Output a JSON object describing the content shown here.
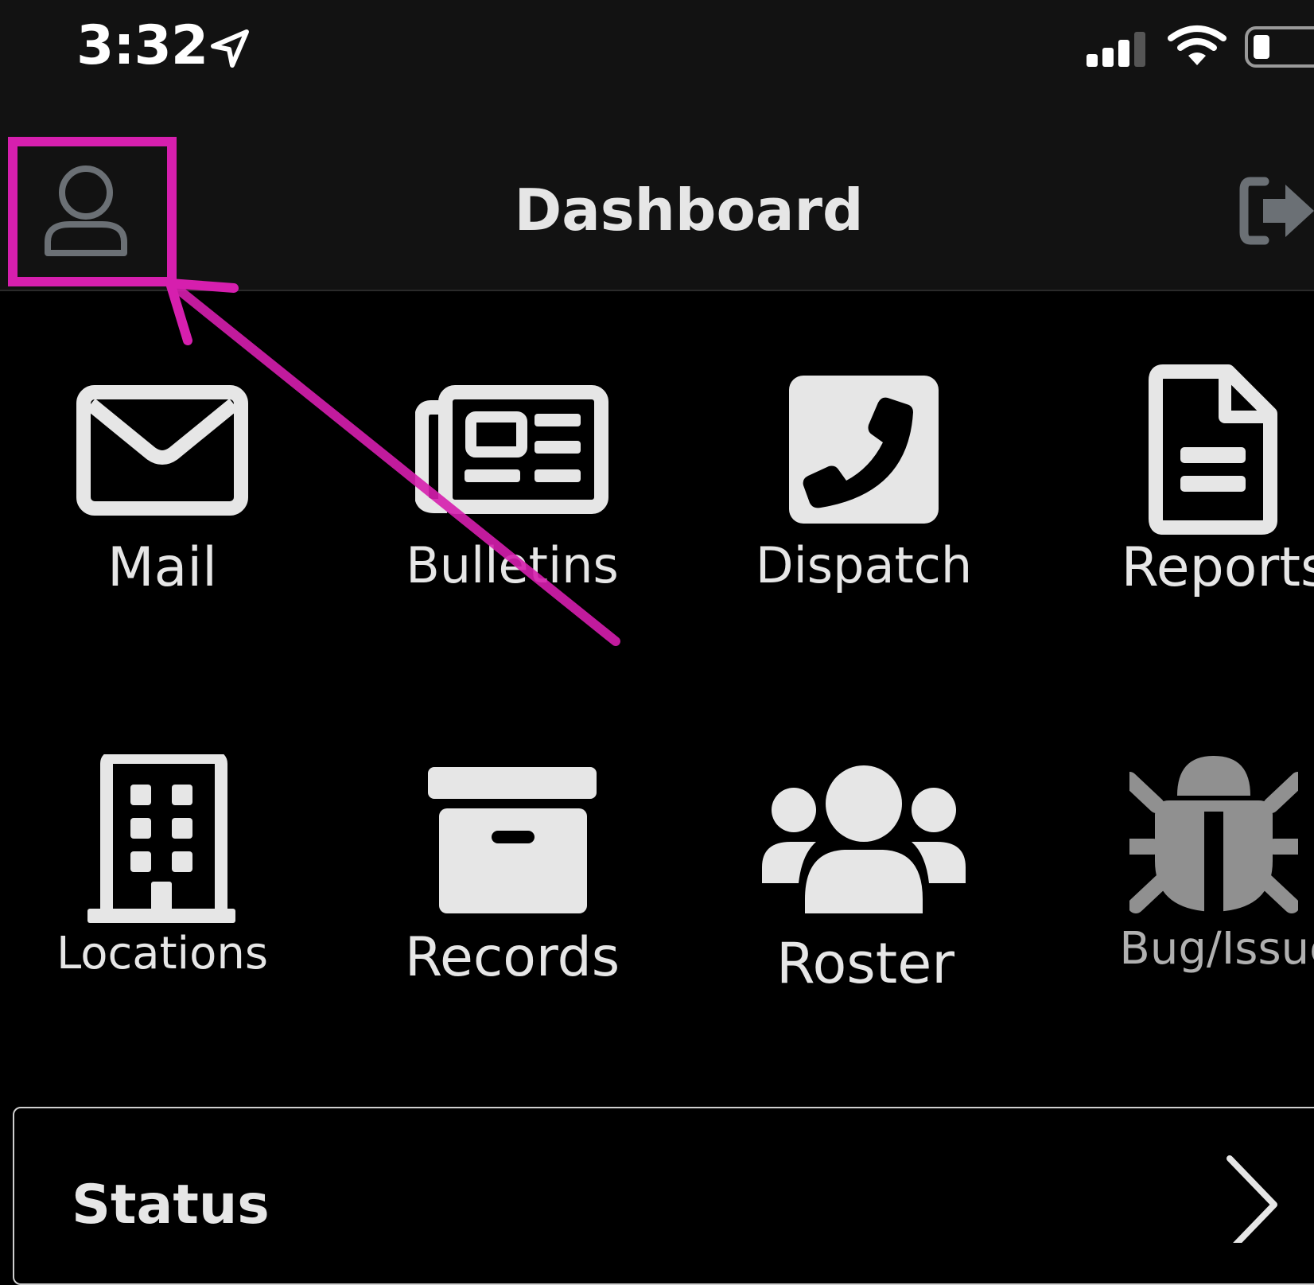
{
  "status_bar": {
    "time": "3:32",
    "icons": [
      "location-arrow-icon",
      "cellular-signal-icon",
      "wifi-icon",
      "battery-icon"
    ]
  },
  "nav": {
    "title": "Dashboard",
    "left_icon": "profile-icon",
    "right_icon": "logout-icon"
  },
  "tiles": [
    {
      "label": "Mail",
      "icon": "envelope-icon"
    },
    {
      "label": "Bulletins",
      "icon": "newspaper-icon"
    },
    {
      "label": "Dispatch",
      "icon": "phone-icon"
    },
    {
      "label": "Reports",
      "icon": "document-icon"
    },
    {
      "label": "Locations",
      "icon": "building-icon"
    },
    {
      "label": "Records",
      "icon": "archive-box-icon"
    },
    {
      "label": "Roster",
      "icon": "users-icon"
    },
    {
      "label": "Bug/Issue",
      "icon": "bug-icon"
    }
  ],
  "status_section": {
    "title": "Status",
    "icon": "chevron-right-icon"
  },
  "annotation": {
    "color": "#d61fae",
    "target": "profile-icon"
  },
  "colors": {
    "background": "#000000",
    "bar": "#121212",
    "icon": "#e6e6e6",
    "muted_icon": "#6b7075"
  }
}
